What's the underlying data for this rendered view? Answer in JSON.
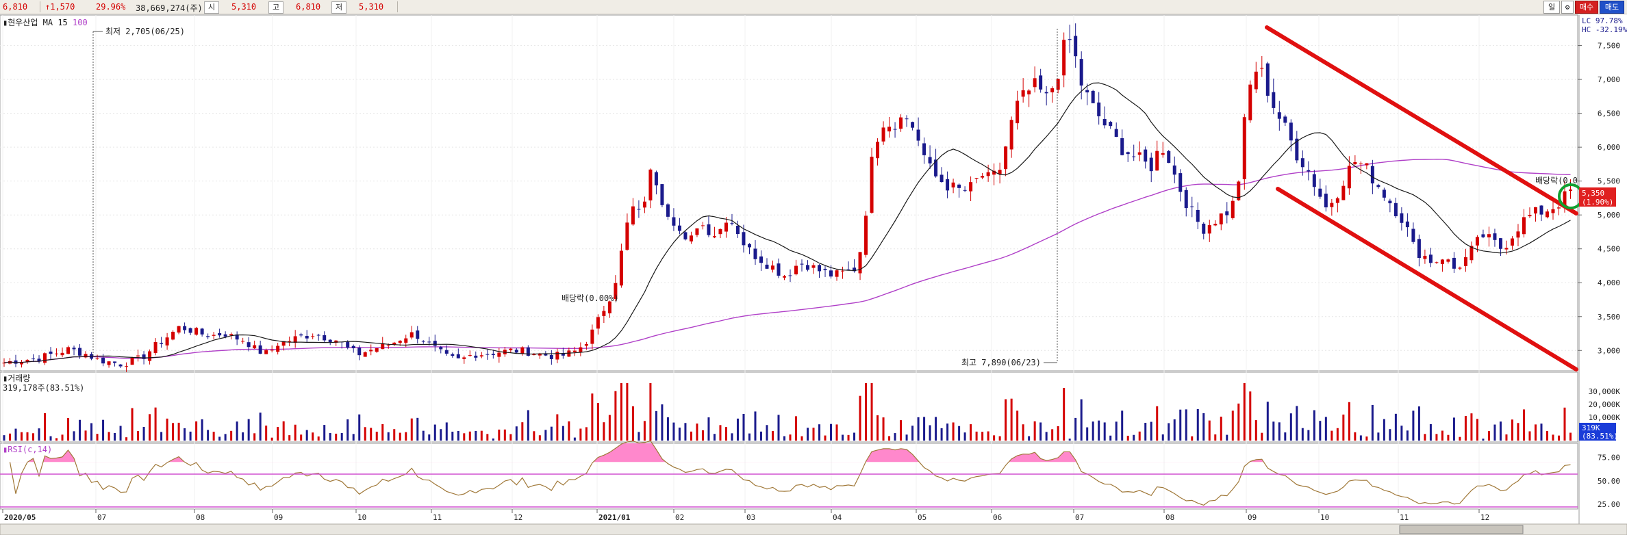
{
  "topbar": {
    "close": "6,810",
    "change": "↑1,570",
    "change_pct": "29.96%",
    "volume": "38,669,274(주)",
    "open_label": "시",
    "open": "5,310",
    "high_label": "고",
    "high": "6,810",
    "low_label": "저",
    "low": "5,310",
    "period_btn": "일",
    "buy_btn": "매수",
    "sell_btn": "매도"
  },
  "legend": {
    "name": "▮현우산업",
    "ma_label": "MA",
    "ma_short": "15",
    "ma_long": "100",
    "lc": "LC  97.78%",
    "hc": "HC -32.19%"
  },
  "annotations": {
    "low": "최저 2,705(06/25)",
    "high": "최고 7,890(06/23)",
    "dividend_1": "배당락(0.00%)",
    "dividend_2": "배당락(0.0",
    "current_price": "5,350",
    "current_pct": "(1.90%)"
  },
  "volume_panel": {
    "title": "▮거래량",
    "value": "319,178주(83.51%)",
    "badge_1": "319K",
    "badge_2": "(83.51%)"
  },
  "rsi_panel": {
    "title": "▮RSI(c,14)"
  },
  "colors": {
    "up": "#d40000",
    "down": "#1a1a8c",
    "ma_short": "#1a1a1a",
    "ma_long": "#b040c8",
    "channel": "#e01010",
    "rsi_line": "#a07838",
    "rsi_fill": "#ff88cc",
    "rsi_band": "#d050d0",
    "circle": "#10a030"
  },
  "chart_data": [
    {
      "type": "candlestick",
      "title": "현우산업",
      "x_labels": [
        "2020/05",
        "07",
        "08",
        "09",
        "10",
        "11",
        "12",
        "2021/01",
        "02",
        "03",
        "04",
        "05",
        "06",
        "07",
        "08",
        "09",
        "10",
        "11",
        "12"
      ],
      "price_ticks": [
        3000,
        3500,
        4000,
        4500,
        5000,
        5500,
        6000,
        6500,
        7000,
        7500
      ],
      "price_tick_labels": [
        "3,000",
        "3,500",
        "4,000",
        "4,500",
        "5,000",
        "5,500",
        "6,000",
        "6,500",
        "7,000",
        "7,500"
      ],
      "ylim": [
        2700,
        7950
      ],
      "close_path": [
        [
          0,
          2820
        ],
        [
          10,
          2860
        ],
        [
          20,
          2880
        ],
        [
          30,
          2950
        ],
        [
          40,
          3020
        ],
        [
          50,
          2950
        ],
        [
          58,
          2860
        ],
        [
          65,
          2830
        ],
        [
          72,
          2800
        ],
        [
          80,
          2850
        ],
        [
          85,
          2900
        ],
        [
          92,
          3050
        ],
        [
          100,
          3200
        ],
        [
          108,
          3350
        ],
        [
          115,
          3300
        ],
        [
          120,
          3250
        ],
        [
          128,
          3220
        ],
        [
          135,
          3260
        ],
        [
          140,
          3200
        ],
        [
          148,
          3150
        ],
        [
          155,
          3000
        ],
        [
          162,
          2950
        ],
        [
          168,
          3100
        ],
        [
          175,
          3150
        ],
        [
          182,
          3200
        ],
        [
          190,
          3250
        ],
        [
          197,
          3200
        ],
        [
          205,
          3150
        ],
        [
          212,
          3000
        ],
        [
          218,
          2950
        ],
        [
          224,
          3000
        ],
        [
          230,
          3050
        ],
        [
          238,
          3100
        ],
        [
          245,
          3200
        ],
        [
          252,
          3250
        ],
        [
          258,
          3150
        ],
        [
          266,
          3000
        ],
        [
          272,
          2900
        ],
        [
          280,
          2850
        ],
        [
          288,
          2950
        ],
        [
          296,
          2950
        ],
        [
          304,
          2980
        ],
        [
          312,
          3000
        ],
        [
          320,
          2990
        ],
        [
          328,
          2950
        ],
        [
          336,
          2920
        ],
        [
          344,
          2930
        ],
        [
          352,
          3000
        ],
        [
          358,
          3150
        ],
        [
          362,
          3300
        ],
        [
          366,
          3500
        ],
        [
          370,
          3700
        ],
        [
          374,
          3900
        ],
        [
          378,
          4300
        ],
        [
          382,
          4800
        ],
        [
          386,
          5100
        ],
        [
          390,
          5000
        ],
        [
          394,
          5300
        ],
        [
          398,
          5700
        ],
        [
          402,
          5400
        ],
        [
          406,
          5100
        ],
        [
          410,
          5000
        ],
        [
          414,
          4800
        ],
        [
          420,
          4500
        ],
        [
          426,
          4900
        ],
        [
          432,
          4800
        ],
        [
          438,
          4700
        ],
        [
          444,
          5000
        ],
        [
          450,
          4800
        ],
        [
          456,
          4500
        ],
        [
          462,
          4400
        ],
        [
          468,
          4300
        ],
        [
          474,
          4200
        ],
        [
          480,
          4100
        ],
        [
          486,
          4250
        ],
        [
          492,
          4300
        ],
        [
          498,
          4200
        ],
        [
          504,
          4150
        ],
        [
          510,
          4100
        ],
        [
          516,
          4150
        ],
        [
          522,
          4200
        ],
        [
          526,
          4500
        ],
        [
          530,
          5200
        ],
        [
          534,
          6000
        ],
        [
          538,
          6300
        ],
        [
          542,
          6500
        ],
        [
          546,
          6200
        ],
        [
          550,
          6600
        ],
        [
          554,
          6400
        ],
        [
          558,
          6300
        ],
        [
          562,
          6100
        ],
        [
          566,
          5800
        ],
        [
          570,
          5600
        ],
        [
          576,
          5500
        ],
        [
          582,
          5400
        ],
        [
          588,
          5350
        ],
        [
          594,
          5400
        ],
        [
          600,
          5600
        ],
        [
          606,
          5500
        ],
        [
          612,
          5700
        ],
        [
          618,
          6300
        ],
        [
          622,
          6600
        ],
        [
          628,
          6800
        ],
        [
          634,
          6900
        ],
        [
          640,
          6700
        ],
        [
          646,
          7000
        ],
        [
          650,
          7400
        ],
        [
          654,
          7600
        ],
        [
          658,
          7300
        ],
        [
          662,
          6900
        ],
        [
          668,
          6600
        ],
        [
          674,
          6400
        ],
        [
          680,
          6200
        ],
        [
          686,
          6000
        ],
        [
          692,
          5900
        ],
        [
          698,
          5800
        ],
        [
          704,
          5700
        ],
        [
          708,
          5900
        ],
        [
          712,
          6000
        ],
        [
          716,
          5800
        ],
        [
          720,
          5500
        ],
        [
          724,
          5300
        ],
        [
          730,
          5000
        ],
        [
          736,
          4800
        ],
        [
          742,
          4900
        ],
        [
          748,
          5000
        ],
        [
          754,
          5100
        ],
        [
          758,
          5500
        ],
        [
          762,
          6400
        ],
        [
          766,
          7000
        ],
        [
          770,
          7200
        ],
        [
          774,
          7000
        ],
        [
          778,
          6700
        ],
        [
          782,
          6500
        ],
        [
          788,
          6200
        ],
        [
          794,
          5900
        ],
        [
          800,
          5700
        ],
        [
          806,
          5400
        ],
        [
          812,
          5100
        ],
        [
          818,
          5300
        ],
        [
          824,
          5600
        ],
        [
          830,
          5800
        ],
        [
          836,
          5700
        ],
        [
          842,
          5500
        ],
        [
          848,
          5300
        ],
        [
          854,
          5100
        ],
        [
          860,
          4900
        ],
        [
          866,
          4500
        ],
        [
          872,
          4400
        ],
        [
          878,
          4300
        ],
        [
          884,
          4400
        ],
        [
          890,
          4200
        ],
        [
          896,
          4300
        ],
        [
          902,
          4500
        ],
        [
          908,
          4700
        ],
        [
          914,
          4600
        ],
        [
          920,
          4500
        ],
        [
          926,
          4700
        ],
        [
          932,
          4900
        ],
        [
          938,
          5000
        ],
        [
          944,
          5050
        ],
        [
          950,
          5100
        ],
        [
          956,
          5200
        ],
        [
          962,
          5350
        ]
      ],
      "volume_ticks": [
        "30,000K",
        "20,000K",
        "10,000K"
      ]
    },
    {
      "type": "line",
      "title": "RSI(c,14)",
      "yticks": [
        25,
        50,
        75
      ],
      "ytick_labels": [
        "25.00",
        "50.00",
        "75.00"
      ],
      "ylim": [
        20,
        90
      ]
    }
  ]
}
